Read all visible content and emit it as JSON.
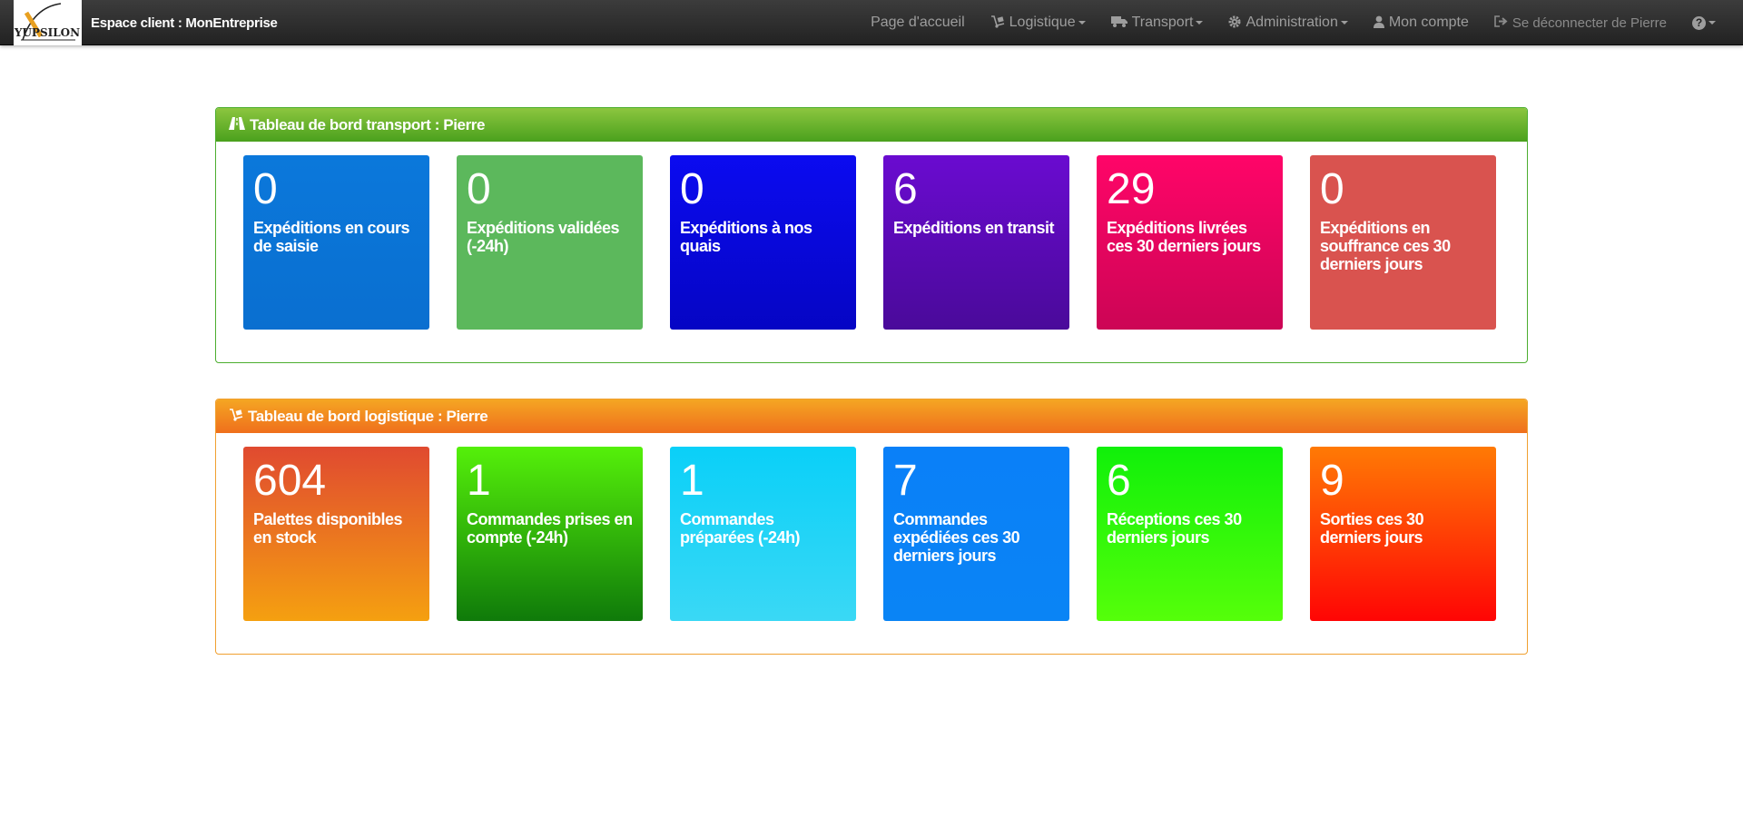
{
  "navbar": {
    "logo_text": "YUPSILON",
    "brand": "Espace client : MonEntreprise",
    "items": [
      {
        "label": "Page d'accueil"
      },
      {
        "label": "Logistique",
        "icon": "hand-truck-icon"
      },
      {
        "label": "Transport",
        "icon": "truck-icon"
      },
      {
        "label": "Administration",
        "icon": "gear-icon"
      },
      {
        "label": "Mon compte",
        "icon": "user-icon"
      },
      {
        "label": "Se déconnecter de Pierre",
        "icon": "sign-out-icon"
      },
      {
        "label": "",
        "icon": "question-circle-icon"
      }
    ],
    "help_glyph": "?"
  },
  "transport": {
    "title": "Tableau de bord transport : Pierre",
    "icon": "road-icon",
    "tiles": [
      {
        "count": "0",
        "label": "Expéditions en cours de saisie",
        "color": "#0b76d8"
      },
      {
        "count": "0",
        "label": "Expéditions validées (-24h)",
        "color": "#5cb85c"
      },
      {
        "count": "0",
        "label": "Expéditions à nos quais",
        "color": "#0a0ae6"
      },
      {
        "count": "6",
        "label": "Expéditions en transit",
        "color": "#5b0bbf"
      },
      {
        "count": "29",
        "label": "Expéditions livrées ces 30 derniers jours",
        "color": "#f0065f"
      },
      {
        "count": "0",
        "label": "Expéditions en souffrance ces 30 derniers jours",
        "color": "#d9534f"
      }
    ]
  },
  "logistique": {
    "title": "Tableau de bord logistique : Pierre",
    "icon": "hand-truck-icon",
    "tiles": [
      {
        "count": "604",
        "label": "Palettes disponibles en stock",
        "color": "#f07a20"
      },
      {
        "count": "1",
        "label": "Commandes prises en compte (-24h)",
        "color": "#2fa10e"
      },
      {
        "count": "1",
        "label": "Commandes préparées (-24h)",
        "color": "#1ed3f5"
      },
      {
        "count": "7",
        "label": "Commandes expédiées ces 30 derniers jours",
        "color": "#0a84f5"
      },
      {
        "count": "6",
        "label": "Réceptions ces 30 derniers jours",
        "color": "#33ff0a"
      },
      {
        "count": "9",
        "label": "Sorties ces 30 derniers jours",
        "color": "#ff3a05"
      }
    ]
  }
}
